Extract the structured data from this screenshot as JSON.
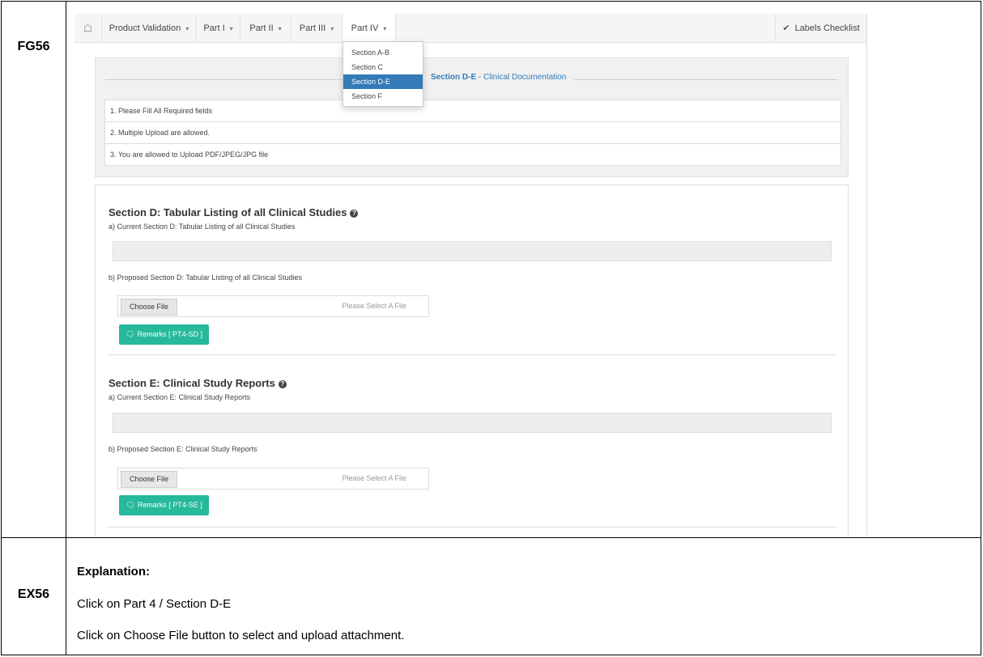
{
  "doc": {
    "fig_label": "FG56",
    "ex_label": "EX56",
    "explanation_title": "Explanation:",
    "explanation_lines": [
      "Click on Part 4 / Section D-E",
      "Click on Choose File button to select and upload attachment."
    ]
  },
  "nav": {
    "home_icon": "home-icon",
    "items": [
      {
        "label": "Product Validation"
      },
      {
        "label": "Part I"
      },
      {
        "label": "Part II"
      },
      {
        "label": "Part III"
      },
      {
        "label": "Part IV"
      }
    ],
    "checklist_label": "Labels Checklist"
  },
  "dropdown": {
    "items": [
      "Section A-B",
      "Section C",
      "Section D-E",
      "Section F"
    ],
    "selected": "Section D-E"
  },
  "header": {
    "legend_bold": "Section D-E",
    "legend_rest": " - Clinical Documentation"
  },
  "rules": [
    "1. Please Fill All Required fields",
    "2. Multiple Upload are allowed.",
    "3. You are allowed to Upload PDF/JPEG/JPG file"
  ],
  "sections": [
    {
      "title": "Section D: Tabular Listing of all Clinical Studies",
      "current_label": "a) Current Section D: Tabular Listing of all Clinical Studies",
      "proposed_label": "b) Proposed Section D: Tabular Listing of all Clinical Studies",
      "choose_label": "Choose File",
      "file_placeholder": "Please Select A File",
      "remarks_label": "Remarks [ PT4-SD ]"
    },
    {
      "title": "Section E: Clinical Study Reports",
      "current_label": "a) Current Section E: Clinical Study Reports",
      "proposed_label": "b) Proposed Section E: Clinical Study Reports",
      "choose_label": "Choose File",
      "file_placeholder": "Please Select A File",
      "remarks_label": "Remarks [ PT4-SE ]"
    }
  ],
  "colors": {
    "primary": "#337ab7",
    "remarks": "#26b99a"
  }
}
